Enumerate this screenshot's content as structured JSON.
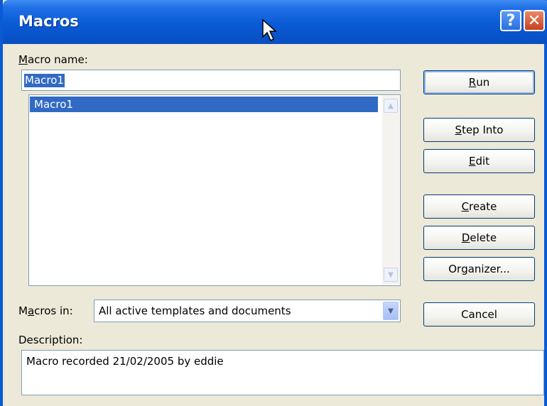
{
  "window": {
    "title": "Macros",
    "help_label": "?",
    "close_label": "✕"
  },
  "macro_name": {
    "label_underlined": "M",
    "label_rest": "acro name:",
    "value": "Macro1"
  },
  "macro_list": {
    "items": [
      "Macro1"
    ],
    "selected": "Macro1",
    "scroll_up_icon": "▲",
    "scroll_down_icon": "▼"
  },
  "buttons": {
    "run": {
      "pre": "",
      "u": "R",
      "post": "un"
    },
    "step_into": {
      "pre": "",
      "u": "S",
      "post": "tep Into"
    },
    "edit": {
      "pre": "",
      "u": "E",
      "post": "dit"
    },
    "create": {
      "pre": "",
      "u": "C",
      "post": "reate"
    },
    "delete": {
      "pre": "",
      "u": "D",
      "post": "elete"
    },
    "organizer": {
      "pre": "Or",
      "u": "g",
      "post": "anizer..."
    },
    "cancel": {
      "pre": "Cancel",
      "u": "",
      "post": ""
    }
  },
  "macros_in": {
    "label_pre": "M",
    "label_u": "a",
    "label_post": "cros in:",
    "value": "All active templates and documents",
    "arrow_icon": "▼"
  },
  "description": {
    "label": "Description:",
    "value": "Macro recorded 21/02/2005 by eddie"
  },
  "colors": {
    "title_bar": "#0a5ad6",
    "selection": "#316ac5",
    "dialog_bg": "#ece9d8"
  }
}
